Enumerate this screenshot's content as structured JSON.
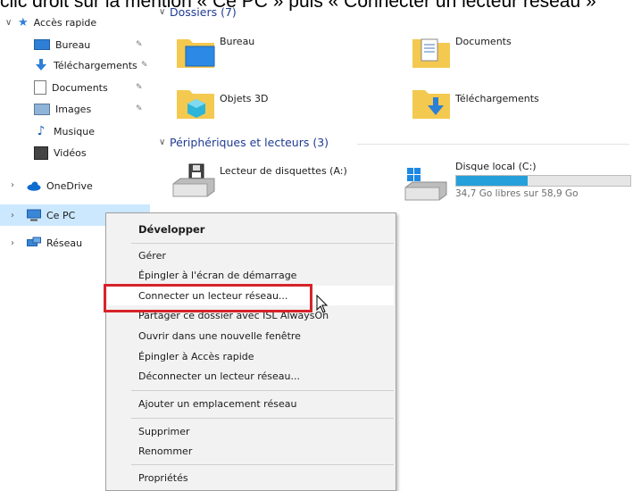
{
  "caption": "clic droit sur la mention « Ce PC » puis « Connecter un lecteur réseau »",
  "sidebar": {
    "quick_access": "Accès rapide",
    "items": [
      {
        "label": "Bureau",
        "icon": "desktop-icon"
      },
      {
        "label": "Téléchargements",
        "icon": "download-icon"
      },
      {
        "label": "Documents",
        "icon": "document-icon"
      },
      {
        "label": "Images",
        "icon": "image-icon"
      },
      {
        "label": "Musique",
        "icon": "music-icon"
      },
      {
        "label": "Vidéos",
        "icon": "video-icon"
      }
    ],
    "onedrive": "OneDrive",
    "this_pc": "Ce PC",
    "network": "Réseau"
  },
  "main": {
    "folders_header": "Dossiers (7)",
    "folders": [
      "Bureau",
      "Documents",
      "Objets 3D",
      "Téléchargements"
    ],
    "devices_header": "Périphériques et lecteurs (3)",
    "floppy_label": "Lecteur de disquettes (A:)",
    "disk_label": "Disque local (C:)",
    "disk_free": "34,7 Go libres sur 58,9 Go",
    "disk_used_fraction": 0.41
  },
  "context_menu": {
    "items": [
      "Développer",
      "Gérer",
      "Épingler à l'écran de démarrage",
      "Connecter un lecteur réseau...",
      "Partager ce dossier avec ISL AlwaysOn",
      "Ouvrir dans une nouvelle fenêtre",
      "Épingler à Accès rapide",
      "Déconnecter un lecteur réseau...",
      "Ajouter un emplacement réseau",
      "Supprimer",
      "Renommer",
      "Propriétés"
    ],
    "highlight_color": "#d6232a"
  },
  "colors": {
    "selection": "#cce8ff",
    "section_header": "#1f3a93",
    "drive_bar": "#26a0da"
  }
}
